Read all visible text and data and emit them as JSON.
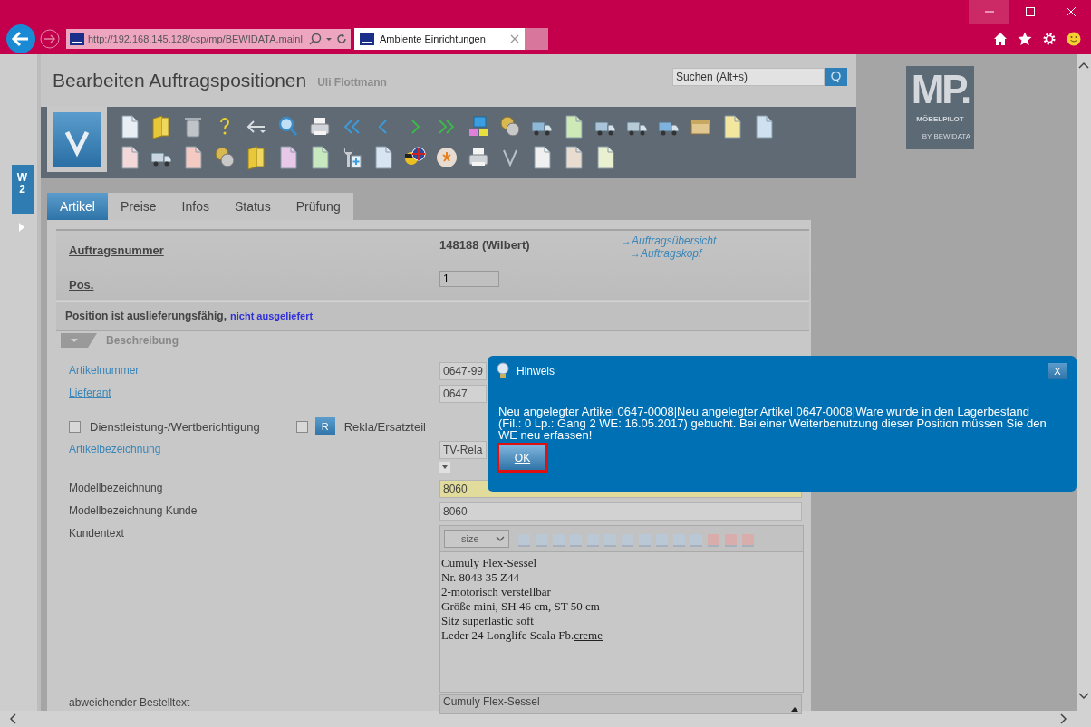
{
  "browser": {
    "address_field": {
      "value": "http://192.168.145.128/csp/mp/BEWIDATA.mainl"
    },
    "tab": {
      "title": "Ambiente Einrichtungen"
    }
  },
  "header": {
    "title": "Bearbeiten Auftragspositionen",
    "user": "Uli Flottmann",
    "search": {
      "placeholder": "Suchen (Alt+s)"
    },
    "logo": {
      "mark": "MP.",
      "brand": "MÖBELPILOT",
      "tagline": "BY BEWIDATA"
    }
  },
  "side_tab": {
    "label": "W 2"
  },
  "tabs": [
    {
      "label": "Artikel",
      "selected": true
    },
    {
      "label": "Preise",
      "selected": false
    },
    {
      "label": "Infos",
      "selected": false
    },
    {
      "label": "Status",
      "selected": false
    },
    {
      "label": "Prüfung",
      "selected": false
    }
  ],
  "order": {
    "label": "Auftragsnummer",
    "value": "148188 (Wilbert)",
    "links": [
      "→Auftragsübersicht",
      "→Auftragskopf"
    ],
    "position_label": "Pos.",
    "position_value": "1"
  },
  "status": {
    "text": "Position ist auslieferungsfähig,",
    "link": "nicht ausgeliefert"
  },
  "section": {
    "title": "Beschreibung",
    "expanded": true
  },
  "fields_top": [
    {
      "label": {
        "text": "Artikelnummer",
        "kind": "blue"
      },
      "value": "0647-99"
    },
    {
      "label": {
        "text": "Lieferant",
        "kind": "link"
      },
      "value": "0647"
    }
  ],
  "options": [
    {
      "label": "Dienstleistung-/Wertberichtigung",
      "checked": false
    },
    {
      "label": "Rekla/Ersatzteil",
      "checked": false,
      "button": "R"
    }
  ],
  "fields": [
    {
      "label": {
        "text": "Artikelbezeichnung",
        "kind": "blue"
      },
      "kind": "select",
      "value": "TV-Rela"
    },
    {
      "label": {
        "text": "Modellbezeichnung",
        "kind": "underlined"
      },
      "kind": "input",
      "value": "8060",
      "highlighted": true
    },
    {
      "label": {
        "text": "Modellbezeichnung Kunde",
        "kind": "plain"
      },
      "kind": "input",
      "value": "8060",
      "highlighted": false
    },
    {
      "label": {
        "text": "Kundentext",
        "kind": "plain"
      },
      "kind": "editor",
      "size_select": "— size —",
      "lines": [
        {
          "text": "Cumuly Flex-Sessel"
        },
        {
          "text": "Nr. 8043 35 Z44"
        },
        {
          "text": "2-motorisch verstellbar"
        },
        {
          "text": "Größe mini, SH 46 cm, ST 50 cm"
        },
        {
          "text": "Sitz superlastic soft"
        },
        {
          "text": "Leder 24 Longlife Scala Fb.",
          "underlined": "creme"
        }
      ]
    },
    {
      "label": {
        "text": "abweichender Bestelltext",
        "kind": "plain"
      },
      "kind": "textarea",
      "value": "Cumuly Flex-Sessel"
    }
  ],
  "dialog": {
    "title": "Hinweis",
    "close": "X",
    "message": "Neu angelegter Artikel 0647-0008|Neu angelegter Artikel 0647-0008|Ware wurde in den Lagerbestand (Fil.: 0 Lp.: Gang 2 WE: 16.05.2017) gebucht. Bei einer Weiterbenutzung dieser Position müssen Sie den WE neu erfassen!",
    "ok": {
      "label": "OK",
      "highlighted": true
    }
  }
}
